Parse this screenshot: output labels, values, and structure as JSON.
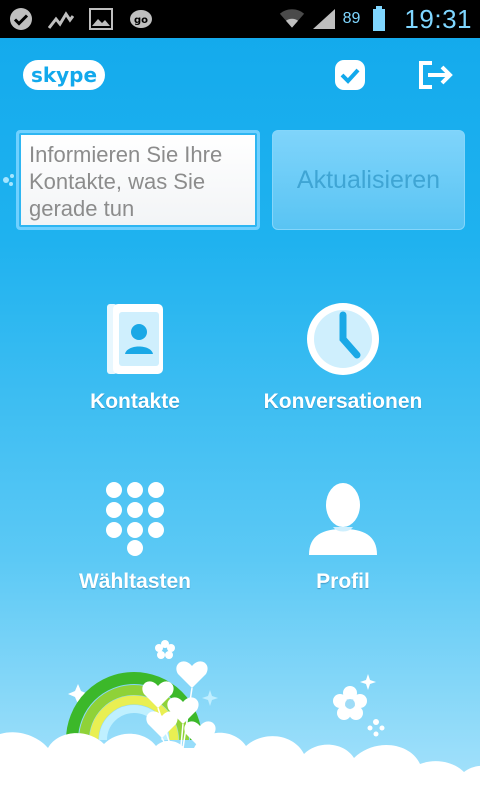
{
  "status_bar": {
    "battery_level": "89",
    "clock": "19:31",
    "icons": [
      "check-circle-icon",
      "activity-graph-icon",
      "image-icon",
      "gapps-icon",
      "wifi-icon",
      "signal-icon",
      "battery-icon"
    ]
  },
  "app": {
    "logo": "skype",
    "actions": [
      "presence-check-icon",
      "sign-out-icon"
    ]
  },
  "status": {
    "placeholder": "Informieren Sie Ihre Kontakte, was Sie gerade tun",
    "value": "",
    "update_label": "Aktualisieren"
  },
  "tiles": [
    {
      "label": "Kontakte",
      "icon": "contacts-book-icon"
    },
    {
      "label": "Konversationen",
      "icon": "clock-icon"
    },
    {
      "label": "Wähltasten",
      "icon": "dialpad-icon"
    },
    {
      "label": "Profil",
      "icon": "person-icon"
    }
  ],
  "colors": {
    "background_top": "#12a9ec",
    "background_bottom": "#a9e3fb",
    "tile_label": "#ffffff",
    "status_text": "#7fd6ff"
  }
}
